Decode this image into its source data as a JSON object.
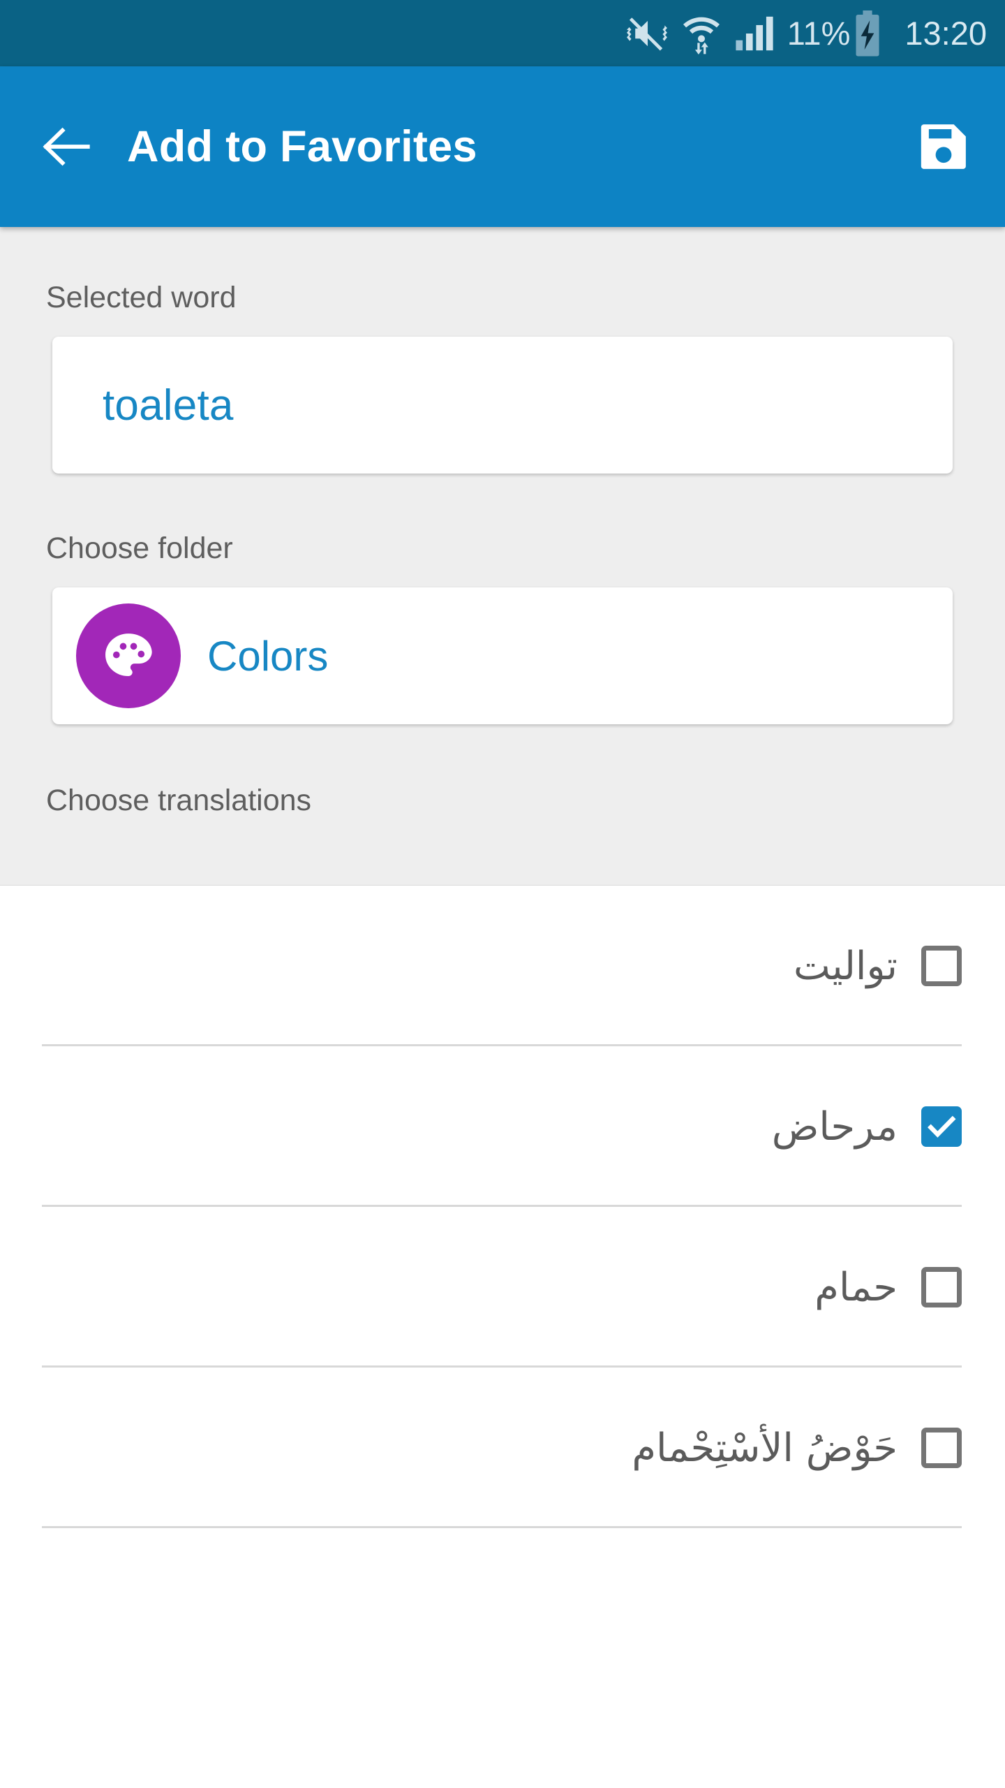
{
  "status_bar": {
    "mute_icon": "vibrate-mute-icon",
    "wifi_icon": "wifi-data-icon",
    "signal_icon": "cellular-signal-icon",
    "battery_percent": "11%",
    "battery_icon": "battery-charging-icon",
    "clock": "13:20",
    "background_color": "#0a6285",
    "text_color": "#d5e6ef"
  },
  "app_bar": {
    "back_icon": "back-arrow-icon",
    "title": "Add to Favorites",
    "save_icon": "floppy-disk-save-icon",
    "background_color": "#0d83c4",
    "title_color": "#ffffff"
  },
  "form": {
    "selected_word_label": "Selected word",
    "selected_word_value": "toaleta",
    "choose_folder_label": "Choose folder",
    "folder_icon": "palette-icon",
    "folder_name": "Colors",
    "folder_avatar_color": "#a227b8",
    "choose_translations_label": "Choose translations",
    "value_color": "#1787c4",
    "label_color": "#5e5e5e",
    "section_background": "#eeeeee"
  },
  "translations": [
    {
      "text": "تواليت",
      "checked": false
    },
    {
      "text": "مرحاض",
      "checked": true
    },
    {
      "text": "حمام",
      "checked": false
    },
    {
      "text": "حَوْضُ الأسْتِحْمام",
      "checked": false
    }
  ],
  "colors": {
    "accent": "#1787c4",
    "checkbox_unchecked_border": "#757575",
    "divider": "#d8d8d8",
    "translation_text": "#5b5b5b"
  }
}
